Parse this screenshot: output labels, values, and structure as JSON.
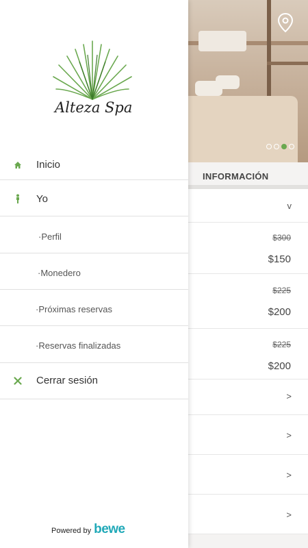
{
  "drawer": {
    "logo_text": "Alteza Spa",
    "menu": [
      {
        "label": "Inicio",
        "icon": "home-icon"
      },
      {
        "label": "Yo",
        "icon": "person-icon"
      },
      {
        "label": "·Perfil"
      },
      {
        "label": "·Monedero"
      },
      {
        "label": "·Próximas reservas"
      },
      {
        "label": "·Reservas finalizadas"
      },
      {
        "label": "Cerrar sesión",
        "icon": "close-icon"
      }
    ],
    "powered_by": "Powered by",
    "brand": "bewe"
  },
  "background": {
    "section_title": "INFORMACIÓN",
    "expand_chevron": "v",
    "prices": [
      {
        "old": "$300",
        "new": "$150"
      },
      {
        "old": "$225",
        "new": "$200"
      },
      {
        "old": "$225",
        "new": "$200"
      }
    ],
    "row_chevron": ">",
    "carousel": {
      "count": 4,
      "active": 3
    }
  },
  "colors": {
    "accent": "#6aa84f",
    "brand": "#21a9b8"
  }
}
